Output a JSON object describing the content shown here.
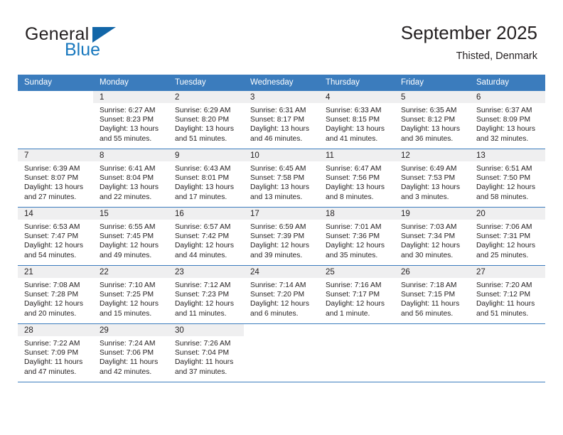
{
  "brand": {
    "name_part1": "General",
    "name_part2": "Blue",
    "accent_color": "#1878be",
    "triangle_color": "#1266a8"
  },
  "header": {
    "title": "September 2025",
    "subtitle": "Thisted, Denmark",
    "header_bg": "#3b7cbd"
  },
  "weekdays": [
    "Sunday",
    "Monday",
    "Tuesday",
    "Wednesday",
    "Thursday",
    "Friday",
    "Saturday"
  ],
  "labels": {
    "sunrise": "Sunrise:",
    "sunset": "Sunset:",
    "daylight": "Daylight:"
  },
  "weeks": [
    [
      {
        "day": "",
        "lines": []
      },
      {
        "day": "1",
        "lines": [
          "Sunrise: 6:27 AM",
          "Sunset: 8:23 PM",
          "Daylight: 13 hours",
          "and 55 minutes."
        ]
      },
      {
        "day": "2",
        "lines": [
          "Sunrise: 6:29 AM",
          "Sunset: 8:20 PM",
          "Daylight: 13 hours",
          "and 51 minutes."
        ]
      },
      {
        "day": "3",
        "lines": [
          "Sunrise: 6:31 AM",
          "Sunset: 8:17 PM",
          "Daylight: 13 hours",
          "and 46 minutes."
        ]
      },
      {
        "day": "4",
        "lines": [
          "Sunrise: 6:33 AM",
          "Sunset: 8:15 PM",
          "Daylight: 13 hours",
          "and 41 minutes."
        ]
      },
      {
        "day": "5",
        "lines": [
          "Sunrise: 6:35 AM",
          "Sunset: 8:12 PM",
          "Daylight: 13 hours",
          "and 36 minutes."
        ]
      },
      {
        "day": "6",
        "lines": [
          "Sunrise: 6:37 AM",
          "Sunset: 8:09 PM",
          "Daylight: 13 hours",
          "and 32 minutes."
        ]
      }
    ],
    [
      {
        "day": "7",
        "lines": [
          "Sunrise: 6:39 AM",
          "Sunset: 8:07 PM",
          "Daylight: 13 hours",
          "and 27 minutes."
        ]
      },
      {
        "day": "8",
        "lines": [
          "Sunrise: 6:41 AM",
          "Sunset: 8:04 PM",
          "Daylight: 13 hours",
          "and 22 minutes."
        ]
      },
      {
        "day": "9",
        "lines": [
          "Sunrise: 6:43 AM",
          "Sunset: 8:01 PM",
          "Daylight: 13 hours",
          "and 17 minutes."
        ]
      },
      {
        "day": "10",
        "lines": [
          "Sunrise: 6:45 AM",
          "Sunset: 7:58 PM",
          "Daylight: 13 hours",
          "and 13 minutes."
        ]
      },
      {
        "day": "11",
        "lines": [
          "Sunrise: 6:47 AM",
          "Sunset: 7:56 PM",
          "Daylight: 13 hours",
          "and 8 minutes."
        ]
      },
      {
        "day": "12",
        "lines": [
          "Sunrise: 6:49 AM",
          "Sunset: 7:53 PM",
          "Daylight: 13 hours",
          "and 3 minutes."
        ]
      },
      {
        "day": "13",
        "lines": [
          "Sunrise: 6:51 AM",
          "Sunset: 7:50 PM",
          "Daylight: 12 hours",
          "and 58 minutes."
        ]
      }
    ],
    [
      {
        "day": "14",
        "lines": [
          "Sunrise: 6:53 AM",
          "Sunset: 7:47 PM",
          "Daylight: 12 hours",
          "and 54 minutes."
        ]
      },
      {
        "day": "15",
        "lines": [
          "Sunrise: 6:55 AM",
          "Sunset: 7:45 PM",
          "Daylight: 12 hours",
          "and 49 minutes."
        ]
      },
      {
        "day": "16",
        "lines": [
          "Sunrise: 6:57 AM",
          "Sunset: 7:42 PM",
          "Daylight: 12 hours",
          "and 44 minutes."
        ]
      },
      {
        "day": "17",
        "lines": [
          "Sunrise: 6:59 AM",
          "Sunset: 7:39 PM",
          "Daylight: 12 hours",
          "and 39 minutes."
        ]
      },
      {
        "day": "18",
        "lines": [
          "Sunrise: 7:01 AM",
          "Sunset: 7:36 PM",
          "Daylight: 12 hours",
          "and 35 minutes."
        ]
      },
      {
        "day": "19",
        "lines": [
          "Sunrise: 7:03 AM",
          "Sunset: 7:34 PM",
          "Daylight: 12 hours",
          "and 30 minutes."
        ]
      },
      {
        "day": "20",
        "lines": [
          "Sunrise: 7:06 AM",
          "Sunset: 7:31 PM",
          "Daylight: 12 hours",
          "and 25 minutes."
        ]
      }
    ],
    [
      {
        "day": "21",
        "lines": [
          "Sunrise: 7:08 AM",
          "Sunset: 7:28 PM",
          "Daylight: 12 hours",
          "and 20 minutes."
        ]
      },
      {
        "day": "22",
        "lines": [
          "Sunrise: 7:10 AM",
          "Sunset: 7:25 PM",
          "Daylight: 12 hours",
          "and 15 minutes."
        ]
      },
      {
        "day": "23",
        "lines": [
          "Sunrise: 7:12 AM",
          "Sunset: 7:23 PM",
          "Daylight: 12 hours",
          "and 11 minutes."
        ]
      },
      {
        "day": "24",
        "lines": [
          "Sunrise: 7:14 AM",
          "Sunset: 7:20 PM",
          "Daylight: 12 hours",
          "and 6 minutes."
        ]
      },
      {
        "day": "25",
        "lines": [
          "Sunrise: 7:16 AM",
          "Sunset: 7:17 PM",
          "Daylight: 12 hours",
          "and 1 minute."
        ]
      },
      {
        "day": "26",
        "lines": [
          "Sunrise: 7:18 AM",
          "Sunset: 7:15 PM",
          "Daylight: 11 hours",
          "and 56 minutes."
        ]
      },
      {
        "day": "27",
        "lines": [
          "Sunrise: 7:20 AM",
          "Sunset: 7:12 PM",
          "Daylight: 11 hours",
          "and 51 minutes."
        ]
      }
    ],
    [
      {
        "day": "28",
        "lines": [
          "Sunrise: 7:22 AM",
          "Sunset: 7:09 PM",
          "Daylight: 11 hours",
          "and 47 minutes."
        ]
      },
      {
        "day": "29",
        "lines": [
          "Sunrise: 7:24 AM",
          "Sunset: 7:06 PM",
          "Daylight: 11 hours",
          "and 42 minutes."
        ]
      },
      {
        "day": "30",
        "lines": [
          "Sunrise: 7:26 AM",
          "Sunset: 7:04 PM",
          "Daylight: 11 hours",
          "and 37 minutes."
        ]
      },
      {
        "day": "",
        "lines": []
      },
      {
        "day": "",
        "lines": []
      },
      {
        "day": "",
        "lines": []
      },
      {
        "day": "",
        "lines": []
      }
    ]
  ]
}
